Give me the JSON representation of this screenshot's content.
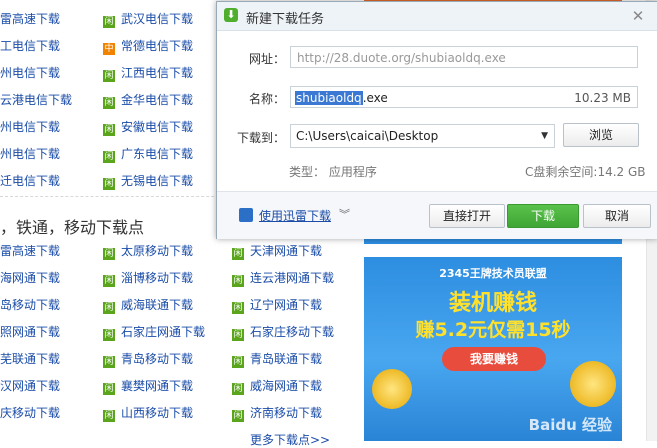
{
  "left_col1": [
    {
      "label": "迅雷高速下载",
      "icon": "green"
    },
    {
      "label": "汇工电信下载",
      "icon": "green"
    },
    {
      "label": "扬州电信下载",
      "icon": "green"
    },
    {
      "label": "连云港电信下载",
      "icon": "green"
    },
    {
      "label": "常州电信下载",
      "icon": "green"
    },
    {
      "label": "徐州电信下载",
      "icon": "green"
    },
    {
      "label": "宿迁电信下载",
      "icon": "green"
    }
  ],
  "left_col2": [
    {
      "label": "武汉电信下载",
      "icon": "green"
    },
    {
      "label": "常德电信下载",
      "icon": "orange"
    },
    {
      "label": "江西电信下载",
      "icon": "green"
    },
    {
      "label": "金华电信下载",
      "icon": "green"
    },
    {
      "label": "安徽电信下载",
      "icon": "green"
    },
    {
      "label": "广东电信下载",
      "icon": "green"
    },
    {
      "label": "无锡电信下载",
      "icon": "green"
    }
  ],
  "section_heading": "，铁通，移动下载点",
  "sec2_col1": [
    "迅雷高速下载",
    "上海网通下载",
    "青岛移动下载",
    "日照网通下载",
    "莱芜联通下载",
    "武汉网通下载",
    "重庆移动下载"
  ],
  "sec2_col2": [
    "太原移动下载",
    "淄博移动下载",
    "威海联通下载",
    "石家庄网通下载",
    "青岛移动下载",
    "襄樊网通下载",
    "山西移动下载"
  ],
  "sec2_col3": [
    "天津网通下载",
    "连云港网通下载",
    "辽宁网通下载",
    "石家庄移动下载",
    "青岛联通下载",
    "威海网通下载",
    "济南移动下载"
  ],
  "more_link": "更多下载点>>",
  "banner": {
    "title": "2345王牌技术员联盟",
    "big": "装机赚钱",
    "line": "赚5.2元仅需15秒",
    "button": "我要赚钱",
    "watermark": "Baidu 经验"
  },
  "dialog": {
    "title": "新建下载任务",
    "url_label": "网址：",
    "url_value": "http://28.duote.org/shubiaoldq.exe",
    "name_label": "名称：",
    "name_selected": "shubiaoldq",
    "name_ext": ".exe",
    "size": "10.23 MB",
    "dest_label": "下载到：",
    "dest_value": "C:\\Users\\caicai\\Desktop",
    "browse": "浏览",
    "type_label": "类型：",
    "type_value": "应用程序",
    "free_label": "C盘剩余空间:",
    "free_value": "14.2 GB",
    "thunder_link": "使用迅雷下载",
    "open_btn": "直接打开",
    "download_btn": "下载",
    "cancel_btn": "取消"
  }
}
